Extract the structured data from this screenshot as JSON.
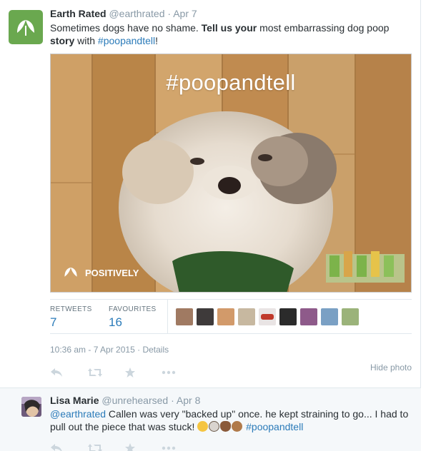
{
  "main_tweet": {
    "fullname": "Earth Rated",
    "username": "@earthrated",
    "separator": "·",
    "date": "Apr 7",
    "text_part1": "Sometimes dogs have no shame. ",
    "text_bold": "Tell us your",
    "text_part2": " most embarrassing dog poop ",
    "text_bold2": "story",
    "text_part3": " with ",
    "hashtag": "#poopandtell",
    "text_end": "!",
    "avatar_icon": "leaf-icon",
    "avatar_color": "#6aa84f"
  },
  "photo": {
    "hashtag_overlay": "#poopandtell",
    "brand_text": "POSITIVELY"
  },
  "stats": {
    "retweets_label": "RETWEETS",
    "retweets_count": "7",
    "favourites_label": "FAVOURITES",
    "favourites_count": "16",
    "favoriter_count": 9
  },
  "details": {
    "timestamp": "10:36 am - 7 Apr 2015",
    "separator": "·",
    "details_link": "Details",
    "hide_photo": "Hide photo"
  },
  "actions": [
    "reply-icon",
    "retweet-icon",
    "favorite-icon",
    "more-icon"
  ],
  "reply_tweet": {
    "fullname": "Lisa Marie",
    "username": "@unrehearsed",
    "separator": "·",
    "date": "Apr 8",
    "mention": "@earthrated",
    "text": " Callen was very \"backed up\" once. he kept straining to go... I had to pull out the piece that was stuck! ",
    "emojis": [
      "flushed-face-emoji",
      "dog-face-emoji",
      "poop-emoji",
      "see-no-evil-monkey-emoji"
    ],
    "hashtag": "#poopandtell"
  },
  "colors": {
    "link": "#2b7bb9",
    "muted": "#8899a6",
    "text": "#292f33",
    "reply_bg": "#f5f8fa"
  }
}
